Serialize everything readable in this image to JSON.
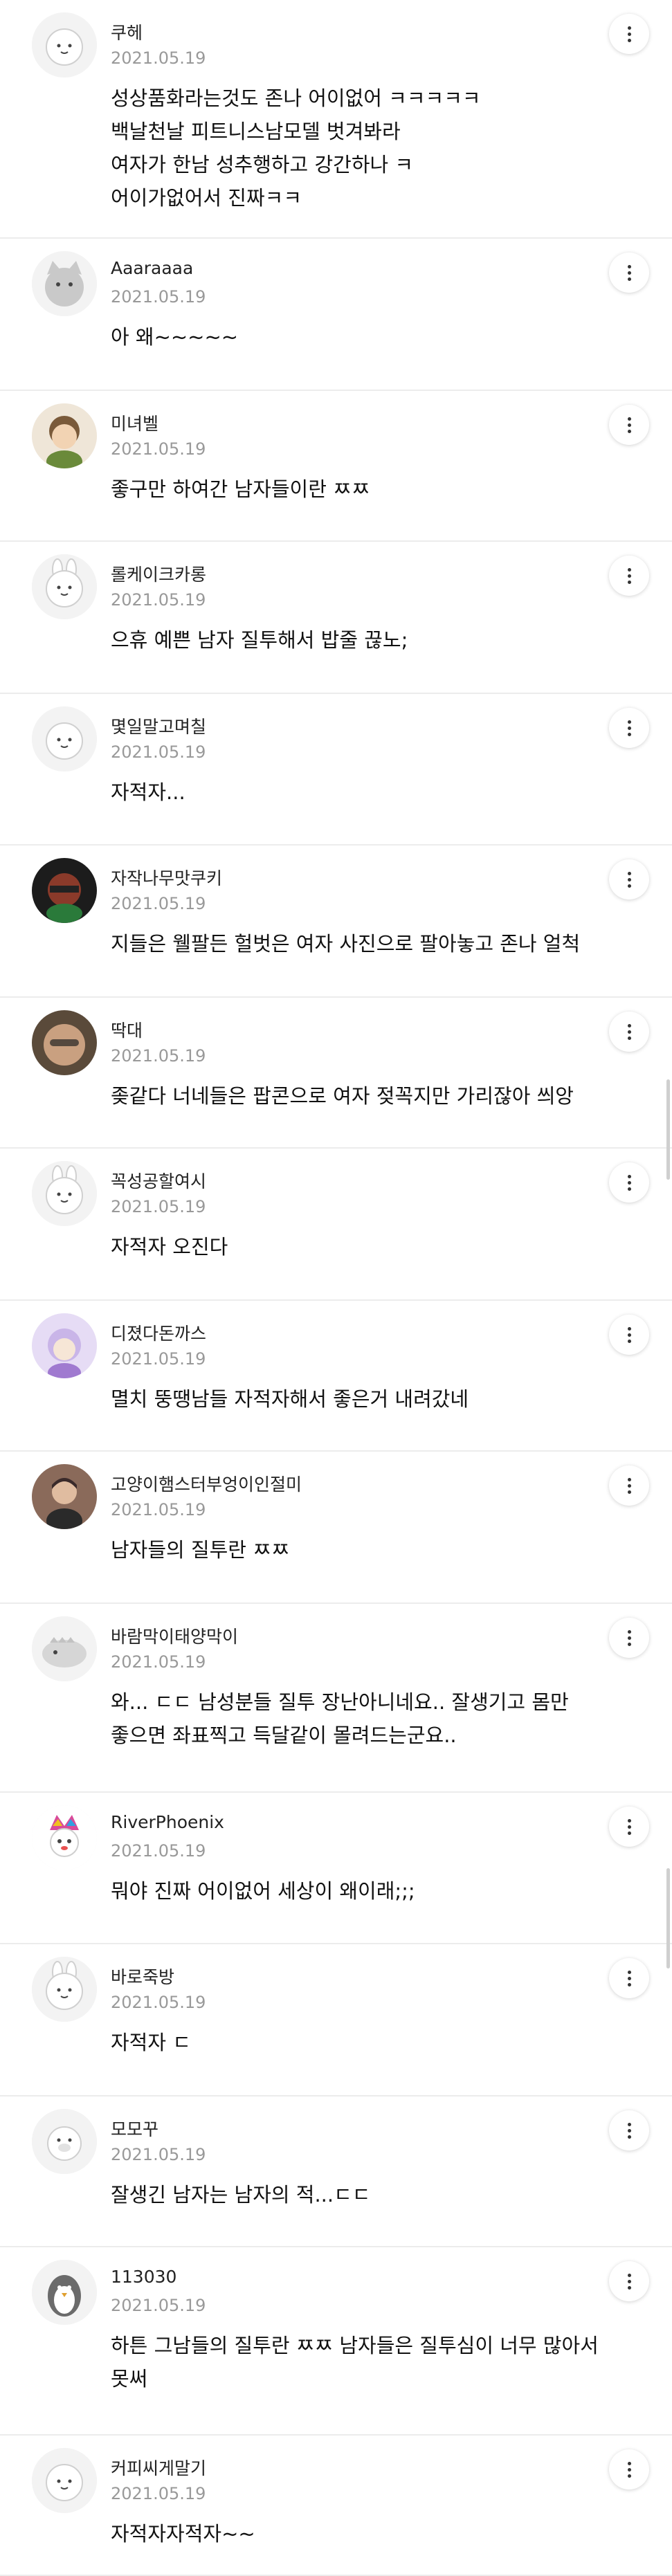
{
  "comments": [
    {
      "nickname": "쿠헤",
      "date": "2021.05.19",
      "text": "성상품화라는것도 존나 어이없어 ㅋㅋㅋㅋㅋ\n백날천날 피트니스남모델 벗겨봐라\n여자가 한남 성추행하고 강간하나 ㅋ\n어이가없어서 진짜ㅋㅋ",
      "avatar": "default-bunny"
    },
    {
      "nickname": "Aaaraaaa",
      "date": "2021.05.19",
      "text": "아 왜~~~~~",
      "avatar": "default-cat"
    },
    {
      "nickname": "미녀벨",
      "date": "2021.05.19",
      "text": "좋구만 하여간 남자들이란 ㅉㅉ",
      "avatar": "photo-character"
    },
    {
      "nickname": "롤케이크카롱",
      "date": "2021.05.19",
      "text": "으휴 예쁜 남자 질투해서 밥줄 끊노;",
      "avatar": "default-bunny-ears"
    },
    {
      "nickname": "몇일말고며칠",
      "date": "2021.05.19",
      "text": "자적자...",
      "avatar": "default-bunny"
    },
    {
      "nickname": "자작나무맛쿠키",
      "date": "2021.05.19",
      "text": "지들은 웰팔든 헐벗은 여자 사진으로 팔아놓고 존나 얼척",
      "avatar": "photo-cookie"
    },
    {
      "nickname": "딱대",
      "date": "2021.05.19",
      "text": "좆같다 너네들은 팝콘으로 여자 젖꼭지만 가리잖아 씌앙",
      "avatar": "photo-face"
    },
    {
      "nickname": "꼭성공할여시",
      "date": "2021.05.19",
      "text": "자적자 오진다",
      "avatar": "default-bunny-ears"
    },
    {
      "nickname": "디졌다돈까스",
      "date": "2021.05.19",
      "text": "멸치 뚱땡남들 자적자해서 좋은거 내려갔네",
      "avatar": "photo-purple"
    },
    {
      "nickname": "고양이햄스터부엉이인절미",
      "date": "2021.05.19",
      "text": "남자들의 질투란 ㅉㅉ",
      "avatar": "photo-portrait"
    },
    {
      "nickname": "바람막이태양막이",
      "date": "2021.05.19",
      "text": "와... ㄷㄷ 남성분들 질투 장난아니네요.. 잘생기고 몸만\n좋으면 좌표찍고 득달같이 몰려드는군요..",
      "avatar": "default-dino"
    },
    {
      "nickname": "RiverPhoenix",
      "date": "2021.05.19",
      "text": "뭐야 진짜 어이없어 세상이 왜이래;;;",
      "avatar": "photo-rainbow"
    },
    {
      "nickname": "바로죽방",
      "date": "2021.05.19",
      "text": "자적자 ㄷ",
      "avatar": "default-bunny-ears"
    },
    {
      "nickname": "모모꾸",
      "date": "2021.05.19",
      "text": "잘생긴 남자는 남자의 적...ㄷㄷ",
      "avatar": "default-pig"
    },
    {
      "nickname": "113030",
      "date": "2021.05.19",
      "text": "하튼 그남들의 질투란 ㅉㅉ 남자들은 질투심이 너무 많아서\n못써",
      "avatar": "default-penguin"
    },
    {
      "nickname": "커피씨게말기",
      "date": "2021.05.19",
      "text": "자적자자적자~~",
      "avatar": "default-bunny"
    }
  ],
  "icons": {
    "more": "more-vertical-icon"
  },
  "colors": {
    "divider": "#ececec",
    "date": "#999999",
    "text": "#111111",
    "scrollbar": "#cfcfcf"
  }
}
